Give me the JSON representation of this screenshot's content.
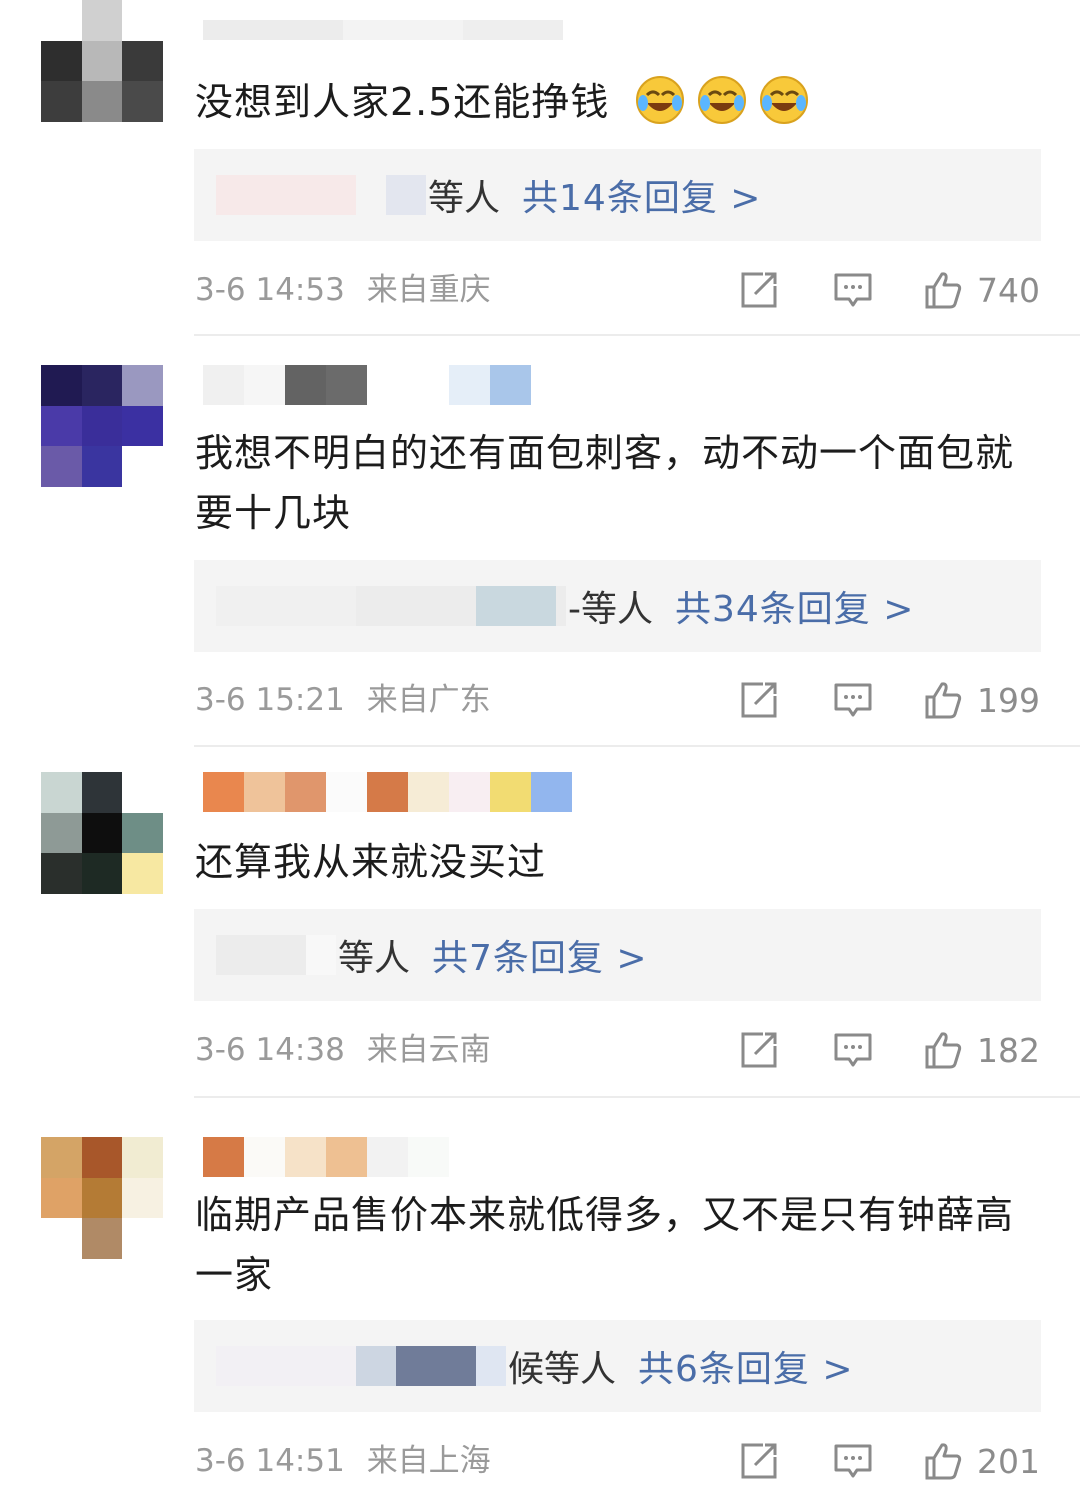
{
  "comments": [
    {
      "text": "没想到人家2.5还能挣钱",
      "emojis": [
        "laughing-crying-emoji",
        "laughing-crying-emoji",
        "laughing-crying-emoji"
      ],
      "reply_users": "等人",
      "reply_count": "共14条回复 >",
      "time": "3-6 14:53",
      "location": "来自重庆",
      "likes": "740"
    },
    {
      "text": "我想不明白的还有面包刺客，动不动一个面包就要十几块",
      "reply_users": "-等人",
      "reply_count": "共34条回复 >",
      "time": "3-6 15:21",
      "location": "来自广东",
      "likes": "199"
    },
    {
      "text": "还算我从来就没买过",
      "reply_users": "等人",
      "reply_count": "共7条回复 >",
      "time": "3-6 14:38",
      "location": "来自云南",
      "likes": "182"
    },
    {
      "text": "临期产品售价本来就低得多，又不是只有钟薛高一家",
      "reply_users": "候等人",
      "reply_count": "共6条回复 >",
      "time": "3-6 14:51",
      "location": "来自上海",
      "likes": "201"
    }
  ],
  "colors": {
    "link": "#4a6da8",
    "meta": "#9a9a9a",
    "reply_bg": "#f4f4f4"
  }
}
